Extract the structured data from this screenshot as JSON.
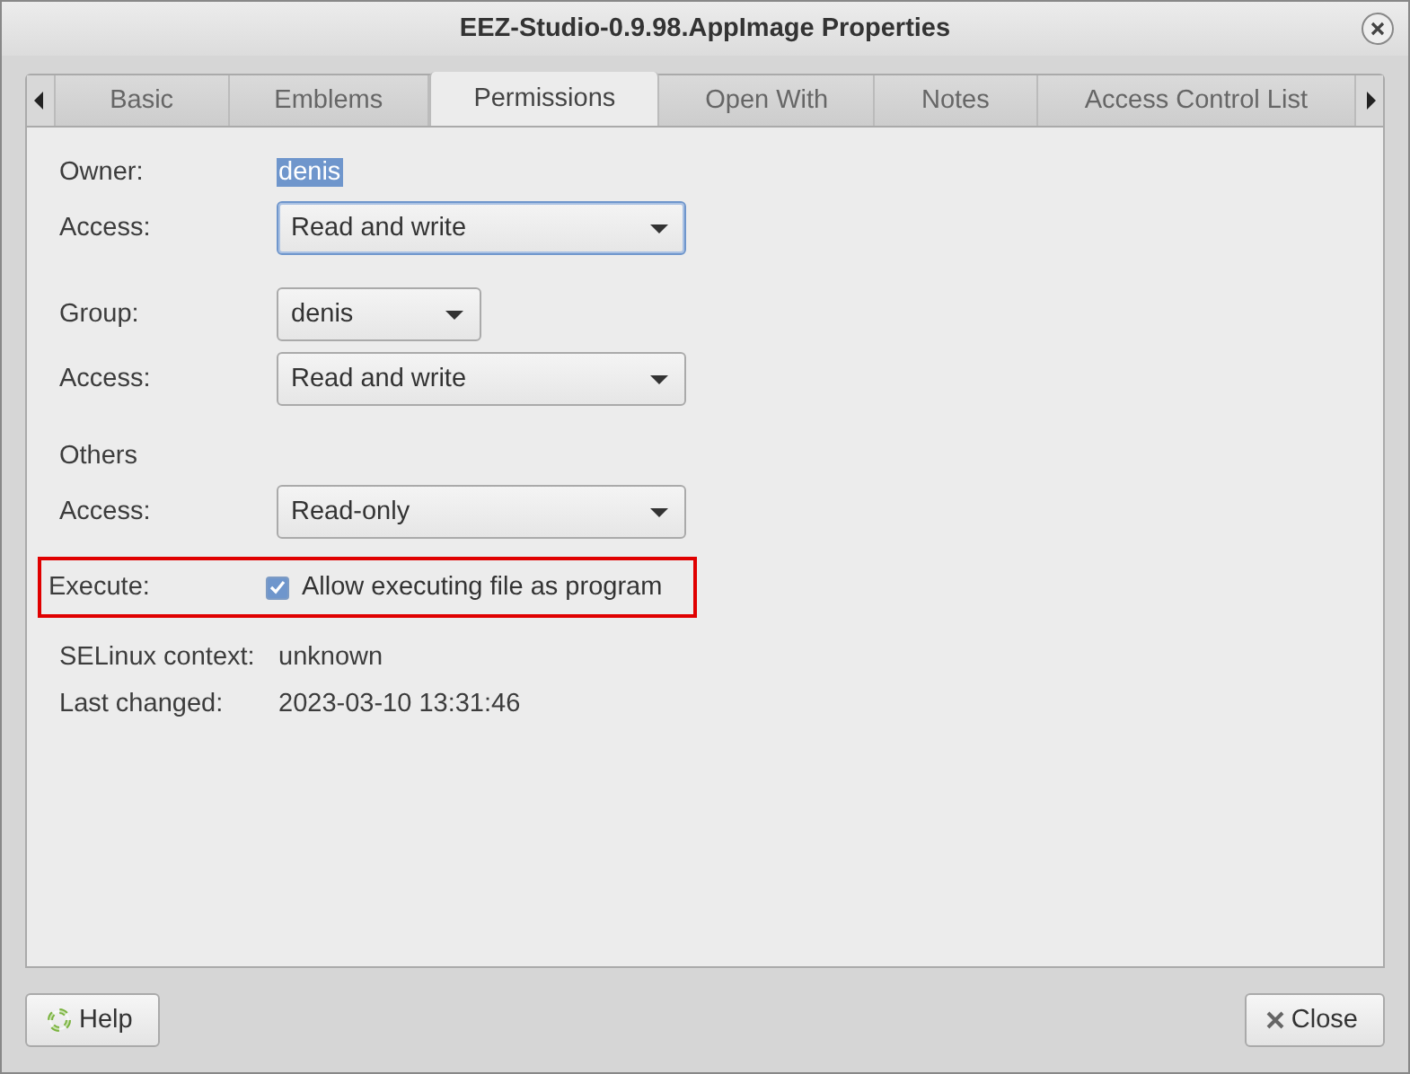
{
  "window": {
    "title": "EEZ-Studio-0.9.98.AppImage Properties"
  },
  "tabs": [
    {
      "label": "Basic",
      "selected": false
    },
    {
      "label": "Emblems",
      "selected": false
    },
    {
      "label": "Permissions",
      "selected": true
    },
    {
      "label": "Open With",
      "selected": false
    },
    {
      "label": "Notes",
      "selected": false
    },
    {
      "label": "Access Control List",
      "selected": false
    }
  ],
  "sections": [
    {
      "highlighted": false,
      "rows": [
        {
          "kind": "text",
          "label": "Owner:",
          "value": "denis",
          "selected": true
        },
        {
          "kind": "dropdown",
          "label": "Access:",
          "value": "Read and write",
          "focused": true
        }
      ]
    },
    {
      "highlighted": false,
      "rows": [
        {
          "kind": "short-dropdown",
          "label": "Group:",
          "value": "denis",
          "focused": false
        },
        {
          "kind": "dropdown",
          "label": "Access:",
          "value": "Read and write",
          "focused": false
        }
      ]
    },
    {
      "highlighted": false,
      "rows": [
        {
          "kind": "heading",
          "label": "Others"
        },
        {
          "kind": "dropdown",
          "label": "Access:",
          "value": "Read-only",
          "focused": false
        }
      ]
    },
    {
      "highlighted": true,
      "rows": [
        {
          "kind": "checkbox",
          "label": "Execute:",
          "value": "Allow executing file as program",
          "checked": true
        }
      ]
    },
    {
      "highlighted": false,
      "rows": [
        {
          "kind": "text",
          "label": "SELinux context:",
          "value": "unknown",
          "selected": false
        },
        {
          "kind": "text",
          "label": "Last changed:",
          "value": "2023-03-10 13:31:46",
          "selected": false
        }
      ]
    }
  ],
  "buttons": [
    {
      "kind": "help",
      "label": "Help"
    },
    {
      "kind": "close",
      "label": "Close"
    }
  ]
}
